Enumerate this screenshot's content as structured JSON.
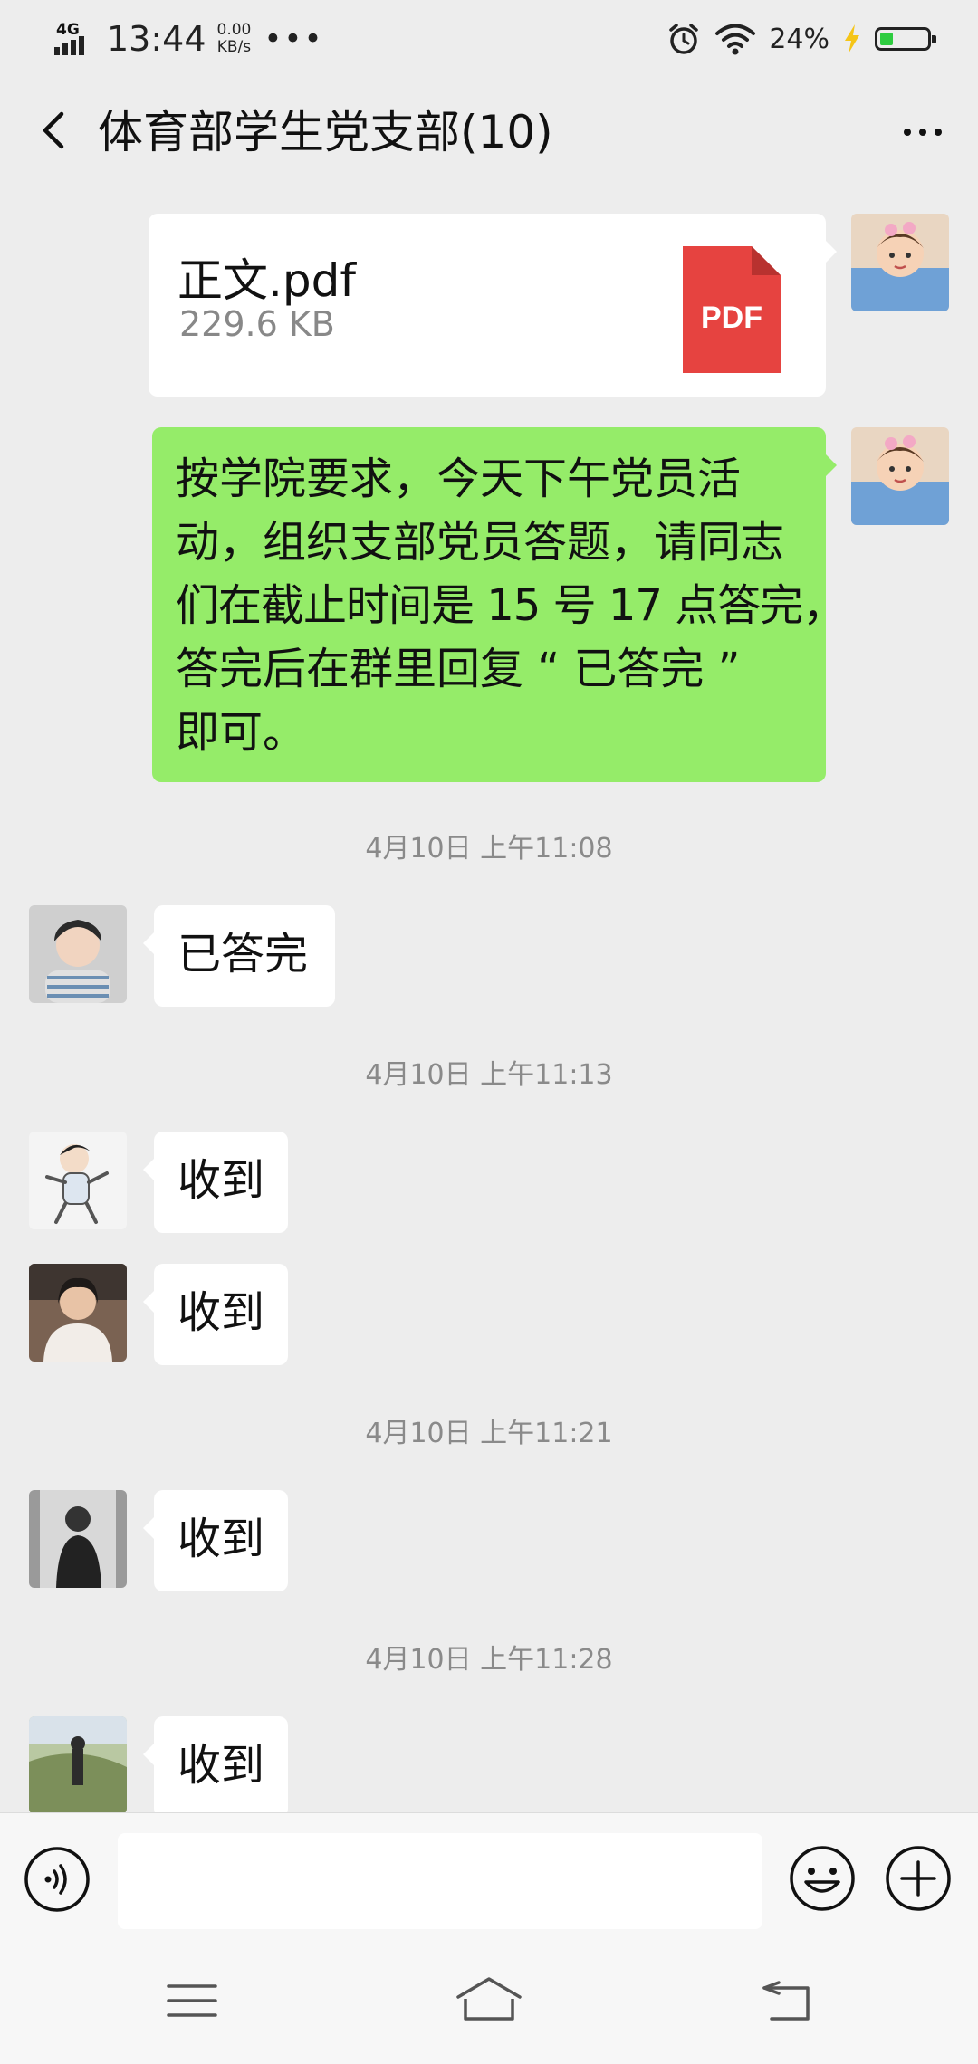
{
  "status_bar": {
    "network": "4G",
    "time": "13:44",
    "speed_value": "0.00",
    "speed_unit": "KB/s",
    "more": "•••",
    "battery_percent": "24%"
  },
  "header": {
    "title": "体育部学生党支部(10)"
  },
  "messages": {
    "file": {
      "name": "正文.pdf",
      "size": "229.6 KB",
      "icon_label": "PDF"
    },
    "notice": {
      "lines": [
        "按学院要求，今天下午党员活",
        "动，组织支部党员答题，请同志",
        "们在截止时间是 15 号 17 点答完，",
        "答完后在群里回复 “ 已答完 ”",
        "即可。"
      ]
    },
    "stamp_1": "4月10日 上午11:08",
    "reply_1": "已答完",
    "stamp_2": "4月10日 上午11:13",
    "reply_2": "收到",
    "reply_3": "收到",
    "stamp_3": "4月10日 上午11:21",
    "reply_4": "收到",
    "stamp_4": "4月10日 上午11:28",
    "reply_5": "收到"
  },
  "input_bar": {
    "voice_icon": "voice-icon",
    "emoji_icon": "emoji-icon",
    "plus_icon": "plus-icon"
  },
  "nav_bar": {
    "menu_icon": "menu-icon",
    "home_icon": "home-icon",
    "back_icon": "back-icon"
  },
  "colors": {
    "chat_background": "#ededed",
    "bubble_sent": "#95ec69",
    "bubble_received": "#ffffff",
    "pdf_red": "#e64340",
    "battery_green": "#2ecc40"
  }
}
